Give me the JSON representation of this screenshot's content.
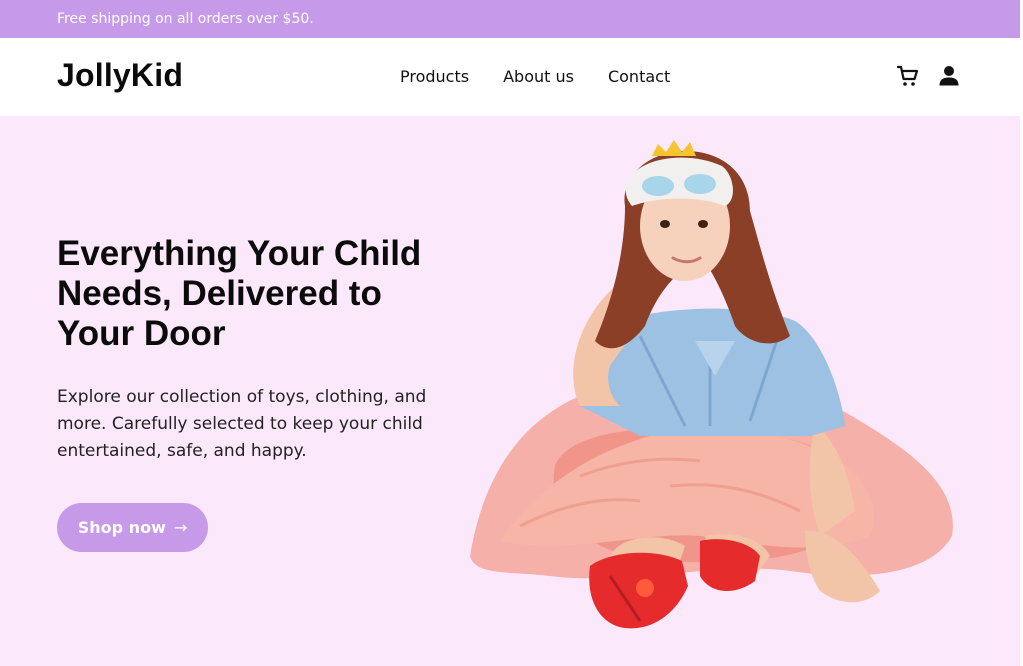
{
  "promo": {
    "text": "Free shipping on all orders over $50."
  },
  "header": {
    "logo": "JollyKid",
    "nav": [
      {
        "label": "Products"
      },
      {
        "label": "About us"
      },
      {
        "label": "Contact"
      }
    ],
    "icons": [
      "cart-icon",
      "user-icon"
    ]
  },
  "hero": {
    "title": "Everything Your Child Needs, Delivered to Your Door",
    "subtitle": "Explore our collection of toys, clothing, and more. Carefully selected to keep your child entertained, safe, and happy.",
    "cta_label": "Shop now",
    "cta_icon": "arrow-right-icon",
    "image": "child-photo"
  },
  "colors": {
    "accent": "#c79ae9",
    "hero_background": "#fce8fb",
    "header_background": "#ffffff",
    "text": "#0b0b0b"
  }
}
